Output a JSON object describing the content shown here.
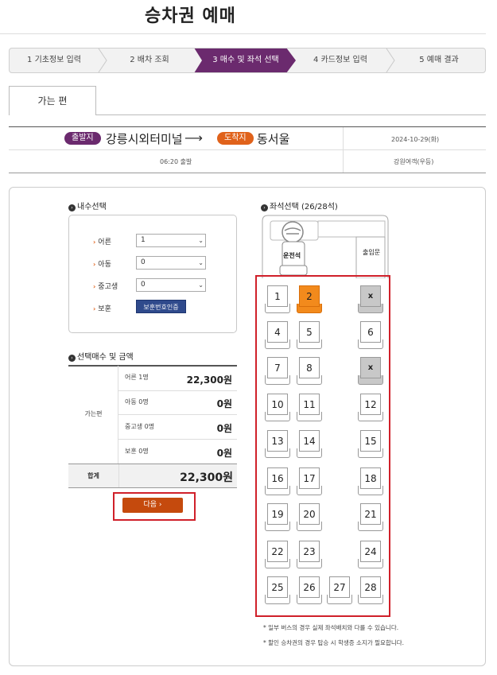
{
  "page": {
    "title": "승차권 예매"
  },
  "steps": [
    {
      "label": "1 기초정보 입력",
      "active": false
    },
    {
      "label": "2 배차 조회",
      "active": false
    },
    {
      "label": "3 매수 및 좌석 선택",
      "active": true
    },
    {
      "label": "4 카드정보 입력",
      "active": false
    },
    {
      "label": "5 예매 결과",
      "active": false
    }
  ],
  "tab": {
    "label": "가는 편"
  },
  "route": {
    "departure_badge": "출발지",
    "departure": "강릉시외터미널",
    "arrival_badge": "도착지",
    "arrival": "동서울",
    "date": "2024-10-29(화)",
    "departure_time": "06:20 출발",
    "company": "강원여객(우등)"
  },
  "count_section": {
    "title": "내수선택",
    "rows": [
      {
        "label": "어른",
        "value": "1"
      },
      {
        "label": "아동",
        "value": "0"
      },
      {
        "label": "중고생",
        "value": "0"
      }
    ],
    "protect_label": "보훈",
    "protect_button": "보훈번호인증"
  },
  "price_section": {
    "title": "선택매수 및 금액",
    "category": "가는편",
    "rows": [
      {
        "label": "어른 1명",
        "value": "22,300원"
      },
      {
        "label": "아동 0명",
        "value": "0원"
      },
      {
        "label": "중고생 0명",
        "value": "0원"
      },
      {
        "label": "보훈 0명",
        "value": "0원"
      }
    ],
    "total_label": "합계",
    "total_value": "22,300원"
  },
  "next_button": {
    "label": "다음 ›"
  },
  "seat_section": {
    "title": "좌석선택 (26/28석)",
    "driver": "운전석",
    "entrance": "출입문",
    "seats": [
      {
        "label": "1",
        "status": "available"
      },
      {
        "label": "2",
        "status": "selected"
      },
      {
        "label": "x",
        "status": "sold"
      },
      {
        "label": "4",
        "status": "available"
      },
      {
        "label": "5",
        "status": "available"
      },
      {
        "label": "6",
        "status": "available"
      },
      {
        "label": "7",
        "status": "available"
      },
      {
        "label": "8",
        "status": "available"
      },
      {
        "label": "x",
        "status": "sold"
      },
      {
        "label": "10",
        "status": "available"
      },
      {
        "label": "11",
        "status": "available"
      },
      {
        "label": "12",
        "status": "available"
      },
      {
        "label": "13",
        "status": "available"
      },
      {
        "label": "14",
        "status": "available"
      },
      {
        "label": "15",
        "status": "available"
      },
      {
        "label": "16",
        "status": "available"
      },
      {
        "label": "17",
        "status": "available"
      },
      {
        "label": "18",
        "status": "available"
      },
      {
        "label": "19",
        "status": "available"
      },
      {
        "label": "20",
        "status": "available"
      },
      {
        "label": "21",
        "status": "available"
      },
      {
        "label": "22",
        "status": "available"
      },
      {
        "label": "23",
        "status": "available"
      },
      {
        "label": "24",
        "status": "available"
      },
      {
        "label": "25",
        "status": "available"
      },
      {
        "label": "26",
        "status": "available"
      },
      {
        "label": "27",
        "status": "available"
      },
      {
        "label": "28",
        "status": "available"
      }
    ],
    "notes": [
      "* 일부 버스의 경우 실제 좌석배치와 다를 수 있습니다.",
      "* 할인 승차권의 경우 탑승 시 학생증 소지가 필요합니다."
    ]
  },
  "colors": {
    "accent": "#6b2a6e",
    "selected_seat": "#f28a1c",
    "next_button": "#c54a0d",
    "highlight_frame": "#d0202a"
  }
}
